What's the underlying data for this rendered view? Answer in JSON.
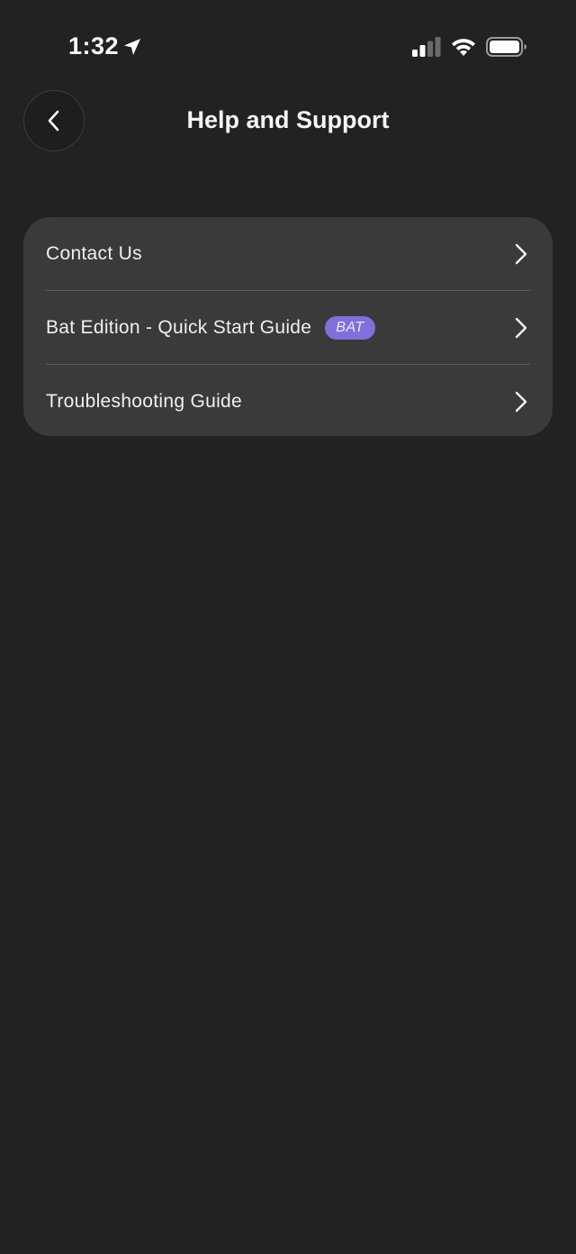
{
  "status_bar": {
    "time": "1:32",
    "icons": [
      "location-arrow-icon",
      "cellular-signal-icon",
      "wifi-icon",
      "battery-icon"
    ]
  },
  "header": {
    "title": "Help and Support",
    "back_icon": "chevron-left-icon"
  },
  "menu": {
    "items": [
      {
        "label": "Contact Us",
        "badge": null,
        "icon": "chevron-right-icon"
      },
      {
        "label": "Bat Edition - Quick Start Guide",
        "badge": "BAT",
        "icon": "chevron-right-icon"
      },
      {
        "label": "Troubleshooting Guide",
        "badge": null,
        "icon": "chevron-right-icon"
      }
    ]
  },
  "colors": {
    "background": "#222222",
    "card": "#3a3a3a",
    "badge": "#7f70db",
    "text": "#f0f0f0"
  }
}
